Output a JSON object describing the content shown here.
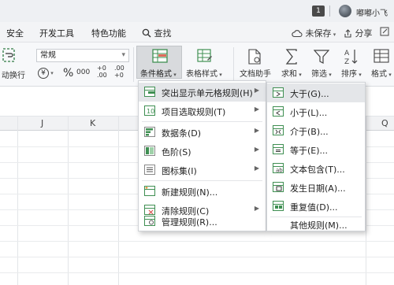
{
  "titlebar": {
    "badge": "1",
    "username": "嘟嘟小飞"
  },
  "menubar": {
    "tabs": [
      "安全",
      "开发工具",
      "特色功能"
    ],
    "search_label": "查找",
    "unsaved_label": "未保存",
    "share_label": "分享"
  },
  "ribbon": {
    "wrap_label": "动换行",
    "number_format_value": "常规",
    "currency_symbol": "¥",
    "percent_symbol": "%",
    "thousands_symbol": "000",
    "increase_decimal": "+0 .00",
    "decrease_decimal": ".00 +0",
    "conditional_format_label": "条件格式",
    "table_style_label": "表格样式",
    "doc_assistant_label": "文档助手",
    "sum_label": "求和",
    "filter_label": "筛选",
    "sort_label": "排序",
    "format_label": "格式"
  },
  "grid": {
    "columns": [
      "J",
      "K",
      "Q"
    ]
  },
  "cond_menu": {
    "items": [
      {
        "label": "突出显示单元格规则(H)",
        "has_submenu": true,
        "icon": "highlight-rules-icon"
      },
      {
        "label": "项目选取规则(T)",
        "has_submenu": true,
        "icon": "top-bottom-rules-icon"
      },
      {
        "label": "数据条(D)",
        "has_submenu": true,
        "icon": "data-bars-icon"
      },
      {
        "label": "色阶(S)",
        "has_submenu": true,
        "icon": "color-scales-icon"
      },
      {
        "label": "图标集(I)",
        "has_submenu": true,
        "icon": "icon-sets-icon"
      },
      {
        "label": "新建规则(N)...",
        "has_submenu": false,
        "icon": "new-rule-icon"
      },
      {
        "label": "清除规则(C)",
        "has_submenu": true,
        "icon": "clear-rules-icon"
      },
      {
        "label": "管理规则(R)...",
        "has_submenu": false,
        "icon": "manage-rules-icon"
      }
    ]
  },
  "highlight_submenu": {
    "items": [
      {
        "label": "大于(G)...",
        "icon": "greater-than-icon"
      },
      {
        "label": "小于(L)...",
        "icon": "less-than-icon"
      },
      {
        "label": "介于(B)...",
        "icon": "between-icon"
      },
      {
        "label": "等于(E)...",
        "icon": "equal-to-icon"
      },
      {
        "label": "文本包含(T)...",
        "icon": "text-contains-icon"
      },
      {
        "label": "发生日期(A)...",
        "icon": "date-occurring-icon"
      },
      {
        "label": "重复值(D)...",
        "icon": "duplicate-values-icon"
      },
      {
        "label": "其他规则(M)...",
        "icon": ""
      }
    ]
  },
  "colors": {
    "accent_green": "#3f8f52",
    "menu_highlight": "#e4e6e9"
  }
}
